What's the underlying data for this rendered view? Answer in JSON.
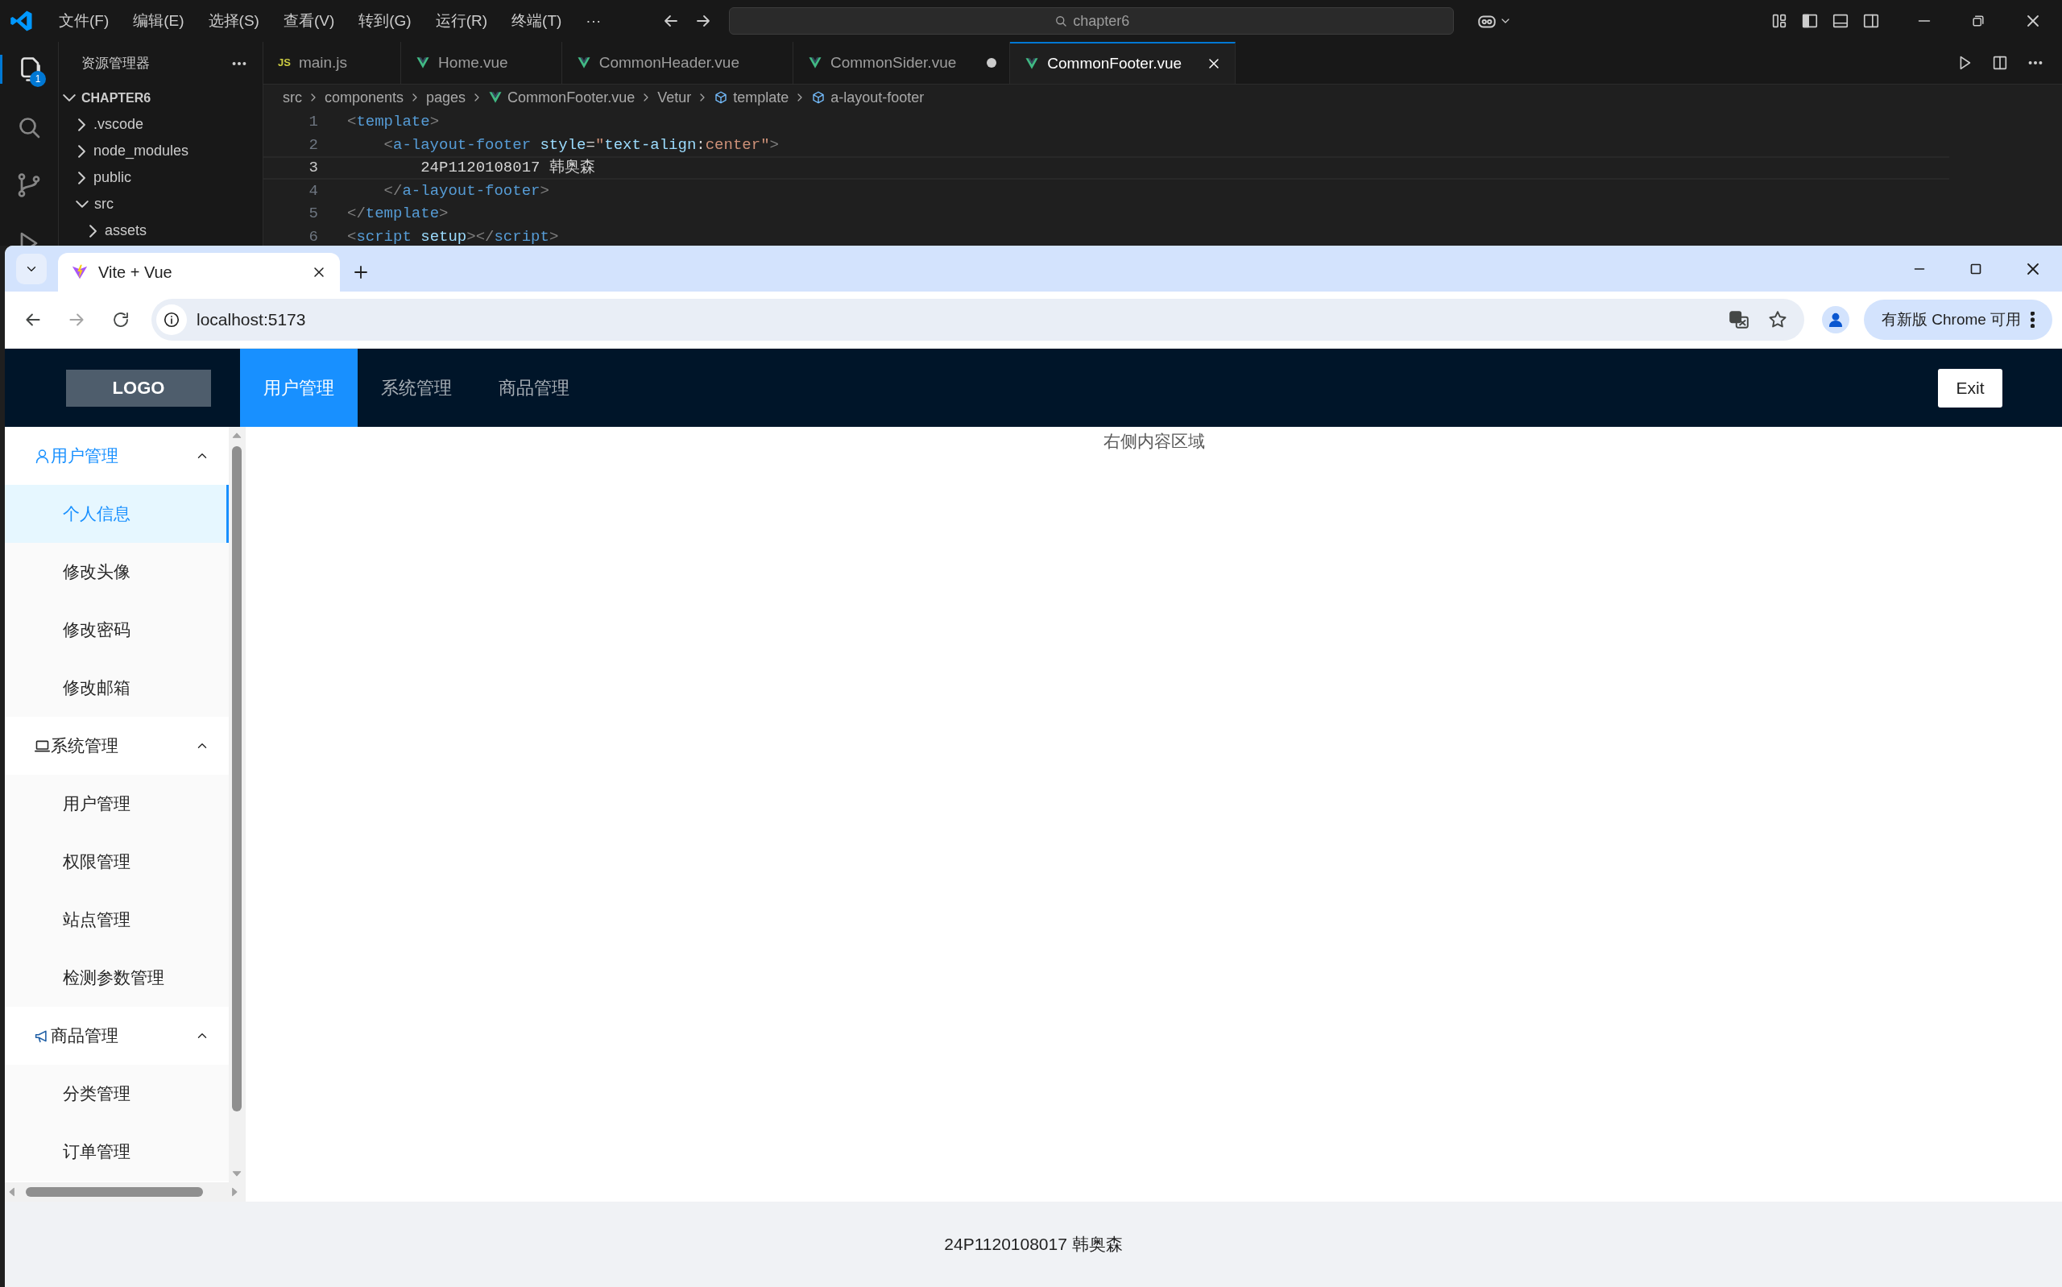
{
  "vscode": {
    "menu": [
      "文件(F)",
      "编辑(E)",
      "选择(S)",
      "查看(V)",
      "转到(G)",
      "运行(R)",
      "终端(T)",
      "···"
    ],
    "search": "chapter6",
    "explorer_badge": "1",
    "explorer": {
      "title": "资源管理器",
      "folder": "CHAPTER6",
      "tree": [
        {
          "label": ".vscode",
          "expanded": false
        },
        {
          "label": "node_modules",
          "expanded": false
        },
        {
          "label": "public",
          "expanded": false
        },
        {
          "label": "src",
          "expanded": true,
          "children": [
            {
              "label": "assets",
              "expanded": false
            }
          ]
        }
      ]
    },
    "tabs": [
      {
        "label": "main.js",
        "kind": "js",
        "icon_text": "JS",
        "selected": false,
        "modified": false
      },
      {
        "label": "Home.vue",
        "kind": "vue",
        "selected": false,
        "modified": false
      },
      {
        "label": "CommonHeader.vue",
        "kind": "vue",
        "selected": false,
        "modified": false
      },
      {
        "label": "CommonSider.vue",
        "kind": "vue",
        "selected": false,
        "modified": true
      },
      {
        "label": "CommonFooter.vue",
        "kind": "vue",
        "selected": true,
        "modified": false
      }
    ],
    "breadcrumbs": [
      {
        "label": "src",
        "kind": "folder"
      },
      {
        "label": "components",
        "kind": "folder"
      },
      {
        "label": "pages",
        "kind": "folder"
      },
      {
        "label": "CommonFooter.vue",
        "kind": "vue"
      },
      {
        "label": "Vetur",
        "kind": "folder"
      },
      {
        "label": "template",
        "kind": "symbol"
      },
      {
        "label": "a-layout-footer",
        "kind": "symbol"
      }
    ],
    "code": [
      {
        "number": "1",
        "current": false,
        "tokens": [
          {
            "text": "<",
            "kind": "punct"
          },
          {
            "text": "template",
            "kind": "tag"
          },
          {
            "text": ">",
            "kind": "punct"
          }
        ]
      },
      {
        "number": "2",
        "current": false,
        "tokens": [
          {
            "text": "    <",
            "kind": "punct"
          },
          {
            "text": "a-layout-footer",
            "kind": "tag"
          },
          {
            "text": " style",
            "kind": "attr"
          },
          {
            "text": "=",
            "kind": "text"
          },
          {
            "text": "\"",
            "kind": "string"
          },
          {
            "text": "text-align",
            "kind": "attr"
          },
          {
            "text": ":",
            "kind": "text"
          },
          {
            "text": "center\"",
            "kind": "string"
          },
          {
            "text": ">",
            "kind": "punct"
          }
        ]
      },
      {
        "number": "3",
        "current": true,
        "tokens": [
          {
            "text": "        24P1120108017 韩奥森",
            "kind": "text"
          }
        ]
      },
      {
        "number": "4",
        "current": false,
        "tokens": [
          {
            "text": "    </",
            "kind": "punct"
          },
          {
            "text": "a-layout-footer",
            "kind": "tag"
          },
          {
            "text": ">",
            "kind": "punct"
          }
        ]
      },
      {
        "number": "5",
        "current": false,
        "tokens": [
          {
            "text": "</",
            "kind": "punct"
          },
          {
            "text": "template",
            "kind": "tag"
          },
          {
            "text": ">",
            "kind": "punct"
          }
        ]
      },
      {
        "number": "6",
        "current": false,
        "tokens": [
          {
            "text": "<",
            "kind": "punct"
          },
          {
            "text": "script",
            "kind": "tag"
          },
          {
            "text": " setup",
            "kind": "attr"
          },
          {
            "text": "></",
            "kind": "punct"
          },
          {
            "text": "script",
            "kind": "tag"
          },
          {
            "text": ">",
            "kind": "punct"
          }
        ]
      }
    ]
  },
  "chrome": {
    "tab_title": "Vite + Vue",
    "url": "localhost:5173",
    "update": "有新版 Chrome 可用"
  },
  "app": {
    "logo": "LOGO",
    "nav": [
      {
        "label": "用户管理",
        "selected": true
      },
      {
        "label": "系统管理",
        "selected": false
      },
      {
        "label": "商品管理",
        "selected": false
      }
    ],
    "exit": "Exit",
    "sidebar": [
      {
        "label": "用户管理",
        "kind": "user",
        "active": true,
        "expanded": true,
        "items": [
          {
            "label": "个人信息",
            "selected": true
          },
          {
            "label": "修改头像",
            "selected": false
          },
          {
            "label": "修改密码",
            "selected": false
          },
          {
            "label": "修改邮箱",
            "selected": false
          }
        ]
      },
      {
        "label": "系统管理",
        "kind": "laptop",
        "active": false,
        "expanded": true,
        "items": [
          {
            "label": "用户管理",
            "selected": false
          },
          {
            "label": "权限管理",
            "selected": false
          },
          {
            "label": "站点管理",
            "selected": false
          },
          {
            "label": "检测参数管理",
            "selected": false
          }
        ]
      },
      {
        "label": "商品管理",
        "kind": "megaphone",
        "active": false,
        "expanded": true,
        "items": [
          {
            "label": "分类管理",
            "selected": false
          },
          {
            "label": "订单管理",
            "selected": false
          }
        ]
      }
    ],
    "content": "右侧内容区域",
    "footer": "24P1120108017 韩奥森"
  }
}
